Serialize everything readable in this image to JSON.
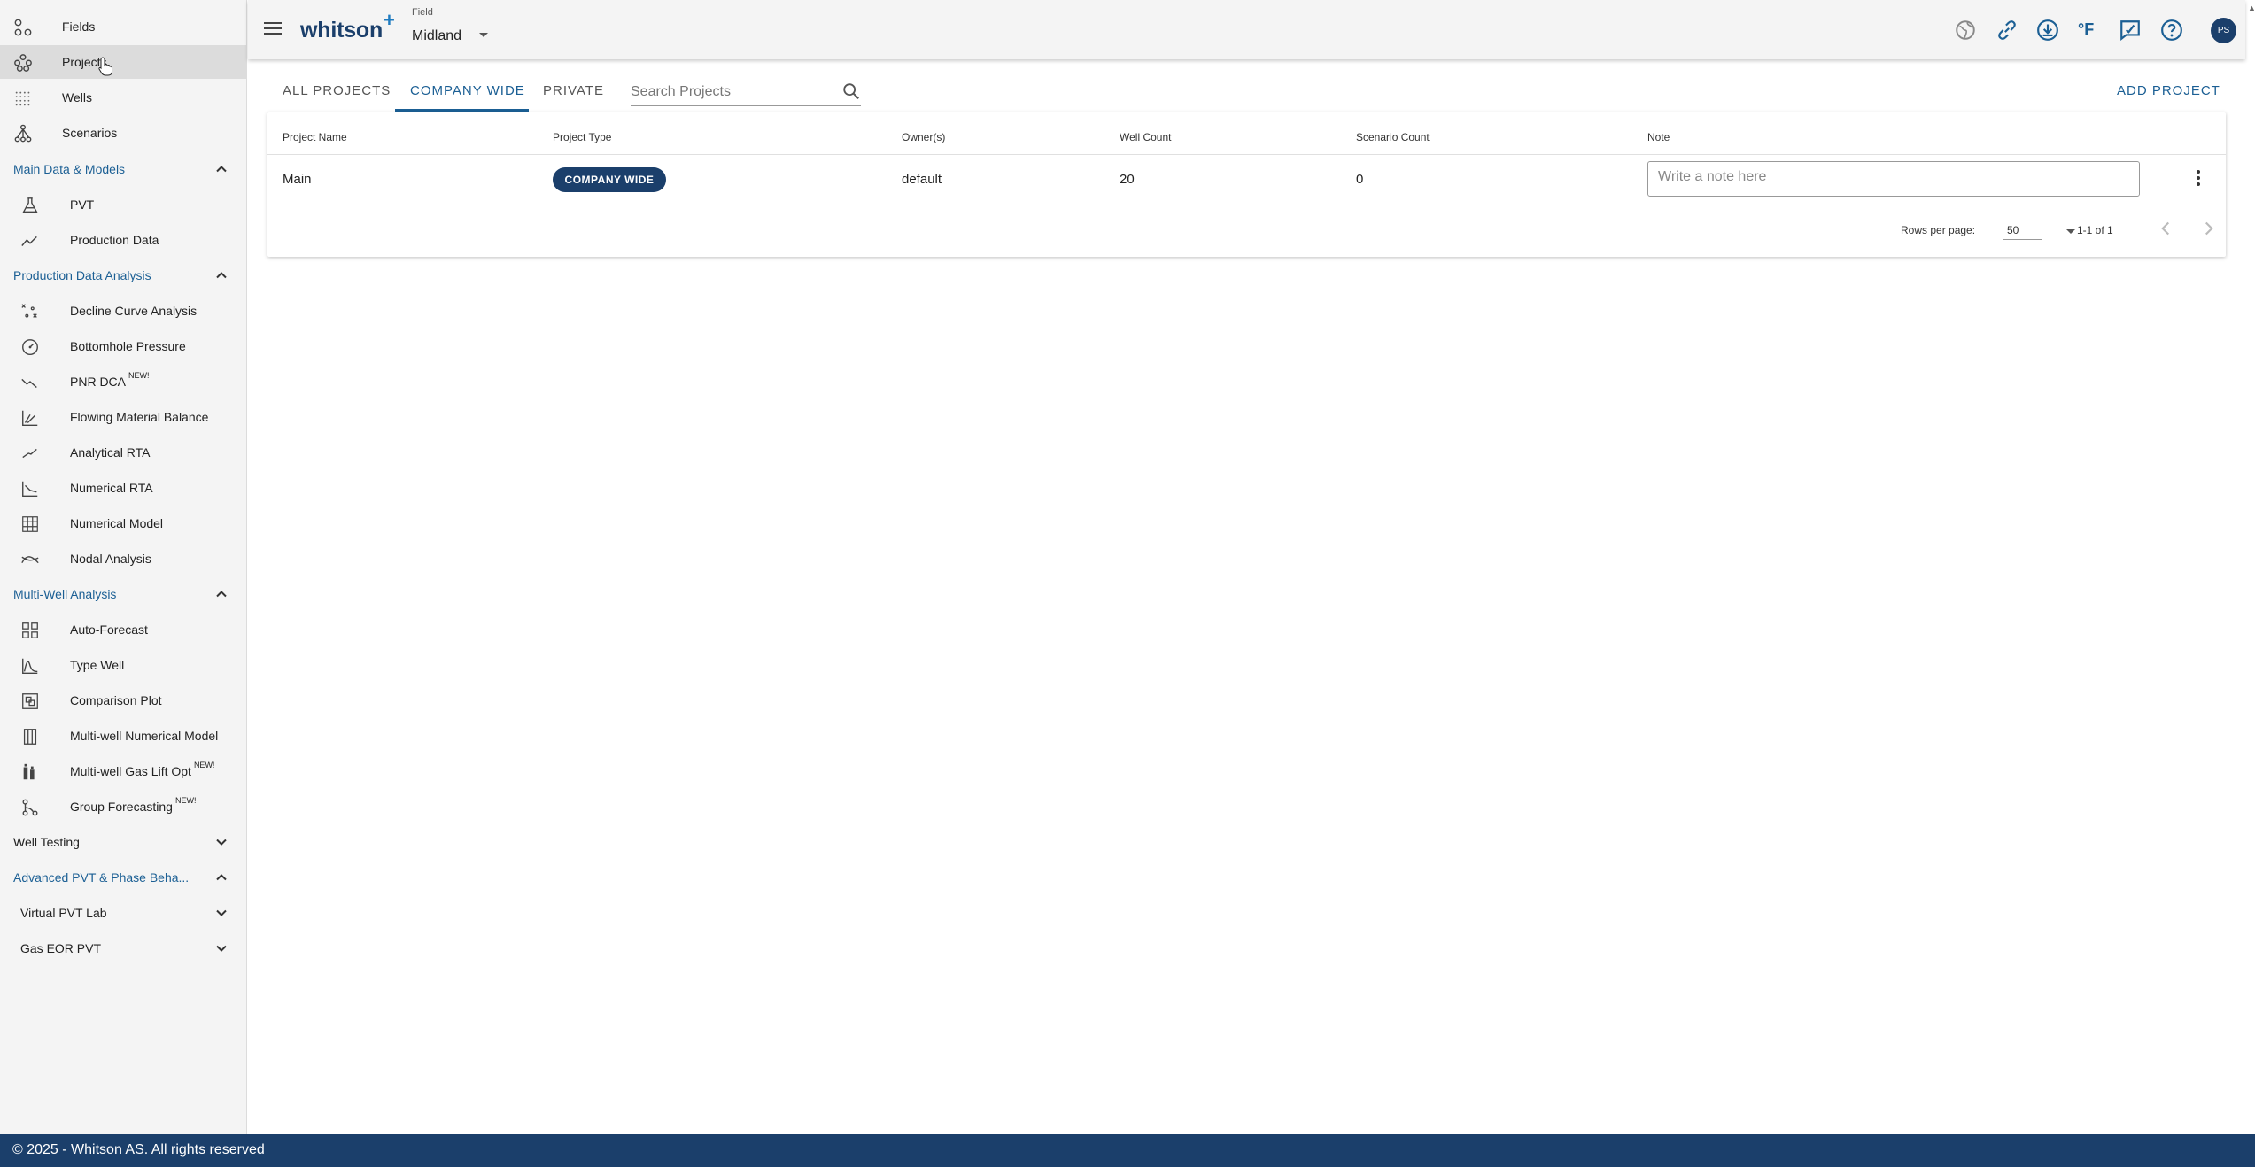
{
  "sidebar": {
    "top_items": [
      {
        "label": "Fields",
        "icon": "fields-icon"
      },
      {
        "label": "Projects",
        "icon": "projects-icon"
      },
      {
        "label": "Wells",
        "icon": "wells-icon"
      },
      {
        "label": "Scenarios",
        "icon": "scenarios-icon"
      }
    ],
    "sections": {
      "main_data": {
        "title": "Main Data & Models",
        "items": [
          {
            "label": "PVT",
            "icon": "flask-icon"
          },
          {
            "label": "Production Data",
            "icon": "trend-icon"
          }
        ]
      },
      "pda": {
        "title": "Production Data Analysis",
        "items": [
          {
            "label": "Decline Curve Analysis",
            "icon": "dca-icon"
          },
          {
            "label": "Bottomhole Pressure",
            "icon": "gauge-icon"
          },
          {
            "label": "PNR DCA",
            "badge": "NEW!",
            "icon": "pnr-icon"
          },
          {
            "label": "Flowing Material Balance",
            "icon": "fmb-icon"
          },
          {
            "label": "Analytical RTA",
            "icon": "analytical-rta-icon"
          },
          {
            "label": "Numerical RTA",
            "icon": "numerical-rta-icon"
          },
          {
            "label": "Numerical Model",
            "icon": "grid-icon"
          },
          {
            "label": "Nodal Analysis",
            "icon": "nodal-icon"
          }
        ]
      },
      "multi_well": {
        "title": "Multi-Well Analysis",
        "items": [
          {
            "label": "Auto-Forecast",
            "icon": "auto-forecast-icon"
          },
          {
            "label": "Type Well",
            "icon": "type-well-icon"
          },
          {
            "label": "Comparison Plot",
            "icon": "comparison-plot-icon"
          },
          {
            "label": "Multi-well Numerical Model",
            "icon": "columns-icon"
          },
          {
            "label": "Multi-well Gas Lift Opt",
            "badge": "NEW!",
            "icon": "gas-lift-icon"
          },
          {
            "label": "Group Forecasting",
            "badge": "NEW!",
            "icon": "group-forecast-icon"
          }
        ]
      },
      "well_testing": {
        "title": "Well Testing"
      },
      "advanced_pvt": {
        "title": "Advanced PVT & Phase Beha..."
      },
      "virtual_pvt": {
        "title": "Virtual PVT Lab"
      },
      "gas_eor": {
        "title": "Gas EOR PVT"
      }
    }
  },
  "header": {
    "logo": "whitson",
    "logo_plus": "+",
    "field_caption": "Field",
    "field_value": "Midland",
    "unit_label": "°F",
    "avatar_initials": "PS"
  },
  "tabs": [
    {
      "label": "ALL PROJECTS",
      "active": false
    },
    {
      "label": "COMPANY WIDE",
      "active": true
    },
    {
      "label": "PRIVATE",
      "active": false
    }
  ],
  "search": {
    "placeholder": "Search Projects",
    "value": ""
  },
  "add_project_label": "ADD PROJECT",
  "table": {
    "columns": [
      "Project Name",
      "Project Type",
      "Owner(s)",
      "Well Count",
      "Scenario Count",
      "Note"
    ],
    "rows": [
      {
        "name": "Main",
        "type": "COMPANY WIDE",
        "owner": "default",
        "well_count": "20",
        "scenario_count": "0",
        "note_placeholder": "Write a note here"
      }
    ],
    "pagination": {
      "rows_per_page_label": "Rows per page:",
      "rows_per_page": "50",
      "range": "1-1 of 1"
    }
  },
  "footer": {
    "text": "© 2025 - Whitson AS. All rights reserved"
  },
  "colors": {
    "brand": "#1b3f6b",
    "accent": "#1b5f94",
    "sidebar_bg": "#f4f4f4"
  }
}
